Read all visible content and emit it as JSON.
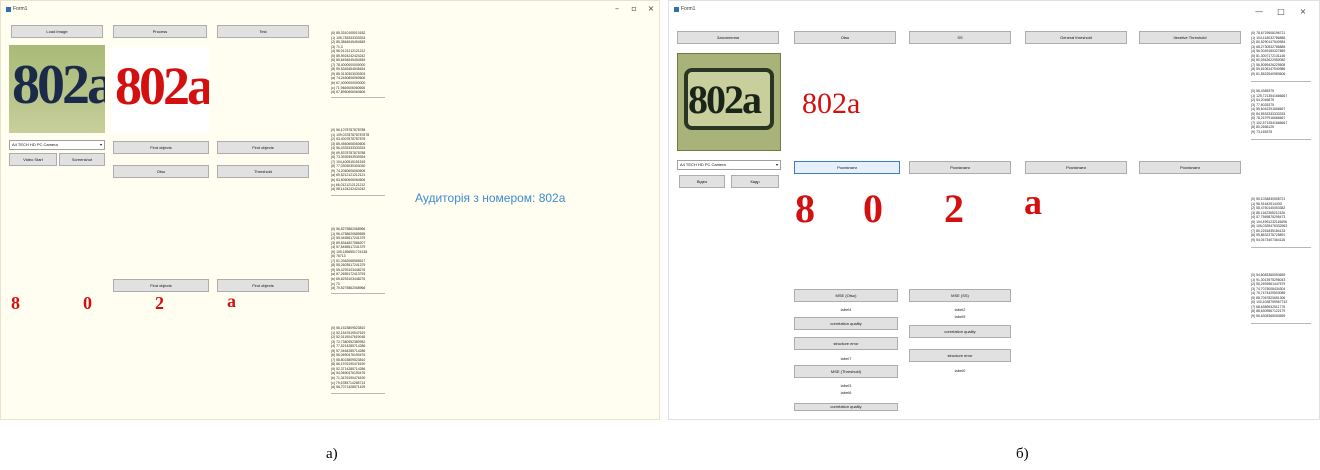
{
  "window_a": {
    "title": "Form1",
    "controls": {
      "minimize": "–",
      "restore": "▫",
      "close": "×"
    },
    "buttons": {
      "load_image": "Load Image",
      "process": "Process",
      "test": "Test",
      "find_objects_1": "Find objects",
      "find_objects_2": "Find objects",
      "otsu": "Otsu",
      "threshold": "Threshold",
      "video_start": "Video Start",
      "screenshot": "Screenshot",
      "find_objects_3": "Find objects",
      "find_objects_4": "Find objects"
    },
    "camera_select": "A4 TECH HD PC Camera",
    "photo_text": "802a",
    "processed_text": "802a",
    "digits": [
      "8",
      "0",
      "2",
      "a"
    ],
    "result_text": "Аудиторія з номером: 802a",
    "value_blocks": [
      [
        "(0) 85,3310105010182",
        "(1) 105,783333333333",
        "(2) 85,3864545454545",
        "(3) 71,3",
        "(4) 56,0121212121212",
        "(5) 85,5924242424242",
        "(6) 85,6454545454545",
        "(7) 78,4000000000000",
        "(8) 59,5345454545454",
        "(9) 85,3130303030303",
        "(a) 74,2460606060606",
        "(b) 67,4000000000000",
        "(c) 71,9460606060606",
        "(d) 67,8960606060606"
      ],
      [
        "(0) 56,1078787878788",
        "(1) 109,03787878787878",
        "(2) 53,4007878787878",
        "(3) 85,4560606060606",
        "(4) 56,0333333333333",
        "(5) 69,5378787878788",
        "(6) 73,3939393939394",
        "(7) 104,400515151515",
        "(8) 77,0303030303030",
        "(9) 74,2060606060606",
        "(a) 69,5212121212121",
        "(b) 63,6060606060606",
        "(c) 66,0121212121212",
        "(d) 58,1424242424242"
      ],
      [
        "(0) 56,5275862068966",
        "(1) 96,4758620689655",
        "(2) 55,0465517241379",
        "(3) 89,8344827586207",
        "(4) 57,5465517241379",
        "(5) 105,1896551724138",
        "(6) 76713",
        "(7) 51,0362068965517",
        "(8) 55,2603517241379",
        "(9) 55,4293103448276",
        "(a) 67,2655172413793",
        "(b) 65,6293103448276",
        "(c) 73",
        "(d) 70,5275862068966"
      ],
      [
        "(0) 56,1523809523810",
        "(1) 52,1547619047619",
        "(2) 52,0119047619048",
        "(3) 72,7380952380952",
        "(4) 77,5214285714286",
        "(5) 57,0464285714286",
        "(6) 56,0690476190476",
        "(7) 58,8023809523810",
        "(8) 66,1976190476190",
        "(9) 52,3714285714286",
        "(a) 54,0690476190476",
        "(b) 71,3476190476190",
        "(c) 79,6785714285714",
        "(d) 56,7071428571429"
      ]
    ]
  },
  "window_b": {
    "title": "Form1",
    "controls": {
      "minimize": "—",
      "restore": "□",
      "close": "×"
    },
    "buttons": {
      "capture": "Захоплення",
      "otsu": "Otsu",
      "ss": "SS",
      "general_threshold": "General threshold",
      "iterative_threshold": "Iterative Threshold",
      "recognize_1": "Розпізнати",
      "recognize_2": "Розпізнати",
      "recognize_3": "Розпізнати",
      "recognize_4": "Розпізнати",
      "video": "Відео",
      "frame": "Кадр",
      "mse_otsu": "MSE (Otsu)",
      "correlation_quality_1": "correlation quality",
      "structure_error_1": "structure error",
      "mse_threshold": "MSE (Threshold)",
      "correlation_quality_3": "correlation quality",
      "mse_ss": "MSE (SS)",
      "correlation_quality_2": "correlation quality",
      "structure_error_2": "structure error"
    },
    "camera_select": "A4 TECH HD PC Camera",
    "photo_text": "802a",
    "processed_text": "802a",
    "digits": [
      "8",
      "0",
      "2",
      "a"
    ],
    "labels": {
      "label4": "label4",
      "label7": "label7",
      "label3": "label3",
      "label6": "label6",
      "label2": "label2",
      "label5": "label5",
      "label0": "label0"
    },
    "value_blocks": [
      [
        "(0) 78,6729508196721",
        "(1) 104,418032786885",
        "(2) 80,5290147540984",
        "(3) 68,2730532786885",
        "(4) 56,0049180327869",
        "(5) 81,3007172131148",
        "(6) 80,0942622950082",
        "(7) 56,5059426229508",
        "(8) 59,6106147540986",
        "(9) 81,5522540983606"
      ],
      [
        "(0) 56,4355375",
        "(1) 125,7213541666667",
        "(2) 54,2046875",
        "(3) 77,6025375",
        "(4) 55,6042291666667",
        "(5) 84,5533333333333",
        "(6) 78,2197916666667",
        "(7) 102,5713541666667",
        "(8) 80,2656125",
        "(9) 73,165375"
      ],
      [
        "(0) 55,1034830508721",
        "(1) 96,9164251443G",
        "(2) 58,4760140053382",
        "(3) 88,1162365212326",
        "(4) 57,7569875295473",
        "(5) 104,4991232116696",
        "(6) 106,0339476332963",
        "(7) 80,2261835184133",
        "(8) 55,8632378725891",
        "(9) 54,0473407364116"
      ],
      [
        "(0) 54,6083365053659",
        "(1) 91,3013975296043",
        "(2) 56,2693961447679",
        "(3) 74,7075008434304",
        "(4) 76,7474429503085",
        "(5) 88,7067820651306",
        "(6) 100,4038759967742",
        "(7) 68,6389932511775",
        "(8) 88,6309567122179",
        "(9) 56,6305365053659"
      ]
    ]
  },
  "captions": [
    "а)",
    "б)"
  ],
  "colors": {
    "accent_digits": "#d40f0f",
    "result_text": "#3f8ccf",
    "window_a_bg": "#fffef0"
  }
}
